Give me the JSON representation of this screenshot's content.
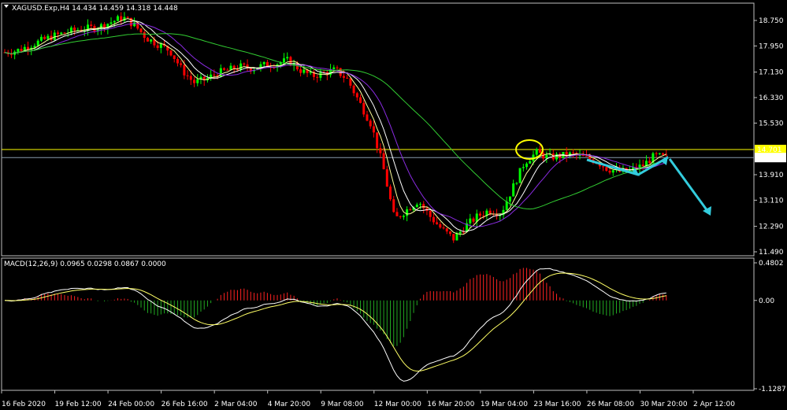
{
  "header": {
    "title": "XAGUSD.Exp,H4  14.434 14.459 14.318 14.448",
    "macd_title": "MACD(12,26,9) 0.0965 0.0298 0.0867 0.0000"
  },
  "colors": {
    "background": "#000000",
    "frame": "#c0c0c0",
    "bull": "#00ff00",
    "bear": "#ff0000",
    "ma_fast": "#ffff99",
    "ma_mid": "#ffffff",
    "ma_slow": "#8a2be2",
    "ma_long": "#32cd32",
    "resistance": "#ffff00",
    "bid_line": "#8899aa",
    "arrow": "#33ccdd",
    "circle": "#ffff00",
    "macd_hist_pos": "#ff2222",
    "macd_hist_neg": "#22aa22",
    "macd_line": "#ffffff",
    "signal_line": "#ffff66"
  },
  "chart_data": [
    {
      "type": "line",
      "panel": "price",
      "y_ticks": [
        "18.750",
        "17.950",
        "17.130",
        "16.330",
        "15.530",
        "14.701",
        "14.448",
        "13.910",
        "13.110",
        "12.290",
        "11.490"
      ],
      "ylim": [
        11.49,
        18.75
      ],
      "x_ticks": [
        "16 Feb 2020",
        "19 Feb 12:00",
        "24 Feb 00:00",
        "26 Feb 16:00",
        "2 Mar 04:00",
        "4 Mar 20:00",
        "9 Mar 08:00",
        "12 Mar 00:00",
        "16 Mar 20:00",
        "19 Mar 04:00",
        "23 Mar 16:00",
        "26 Mar 08:00",
        "30 Mar 20:00",
        "2 Apr 12:00"
      ],
      "highlight_labels": [
        {
          "value": 14.701,
          "text": "14.701"
        },
        {
          "value": 14.448,
          "text": "14.448"
        }
      ],
      "price_path": [
        17.75,
        17.8,
        17.95,
        18.1,
        18.25,
        18.35,
        18.45,
        18.5,
        18.55,
        18.7,
        18.85,
        18.6,
        18.2,
        18.0,
        17.8,
        17.2,
        16.8,
        16.9,
        17.1,
        17.2,
        17.3,
        17.25,
        17.35,
        17.4,
        17.5,
        17.2,
        17.0,
        17.1,
        17.2,
        16.9,
        16.2,
        15.5,
        14.2,
        12.5,
        12.8,
        13.1,
        12.6,
        12.2,
        11.9,
        12.3,
        12.6,
        12.8,
        12.7,
        13.5,
        14.3,
        14.6,
        14.45,
        14.5,
        14.55,
        14.45,
        14.35,
        14.1,
        14.0,
        14.05,
        14.2,
        14.5,
        14.448
      ],
      "macd_range": [
        -1.1287,
        0.4802
      ],
      "macd_ticks": [
        "0.4802",
        "0.00",
        "-1.1287"
      ]
    }
  ]
}
